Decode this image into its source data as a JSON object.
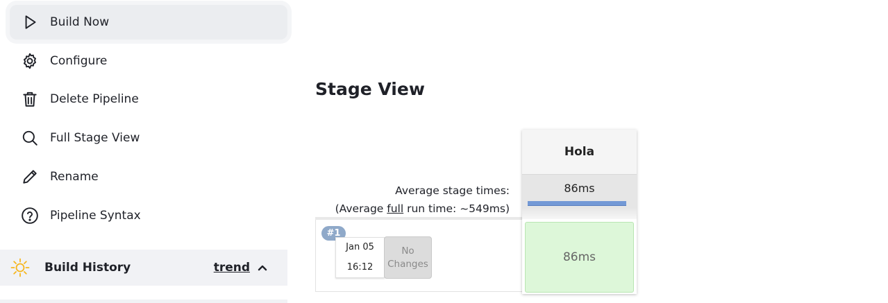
{
  "sidebar": {
    "tasks": [
      {
        "label": "Build Now",
        "icon": "play-icon"
      },
      {
        "label": "Configure",
        "icon": "gear-icon"
      },
      {
        "label": "Delete Pipeline",
        "icon": "trash-icon"
      },
      {
        "label": "Full Stage View",
        "icon": "search-icon"
      },
      {
        "label": "Rename",
        "icon": "pencil-icon"
      },
      {
        "label": "Pipeline Syntax",
        "icon": "help-circle-icon"
      }
    ],
    "build_history": {
      "title": "Build History",
      "trend_label": "trend",
      "icon": "sun-icon",
      "collapse_icon": "chevron-up-icon"
    }
  },
  "stage_view": {
    "title": "Stage View",
    "avg_line1": "Average stage times:",
    "avg_line2_prefix": "(Average ",
    "avg_line2_link": "full",
    "avg_line2_suffix": " run time: ~549ms)",
    "stages": [
      {
        "name": "Hola",
        "avg_time": "86ms",
        "avg_fraction": 1.0
      }
    ],
    "builds": [
      {
        "number": "#1",
        "date": "Jan 05",
        "time": "16:12",
        "changes_line1": "No",
        "changes_line2": "Changes",
        "stage_times": [
          "86ms"
        ],
        "status_color": "#ddf7d9"
      }
    ]
  },
  "colors": {
    "active_bg": "#ebedf0",
    "history_bg": "#f1f2f5",
    "sun": "#f6b61e",
    "badge": "#8fa9c9",
    "success_cell": "#ddf7d9",
    "avg_bar": "#7399d6"
  }
}
